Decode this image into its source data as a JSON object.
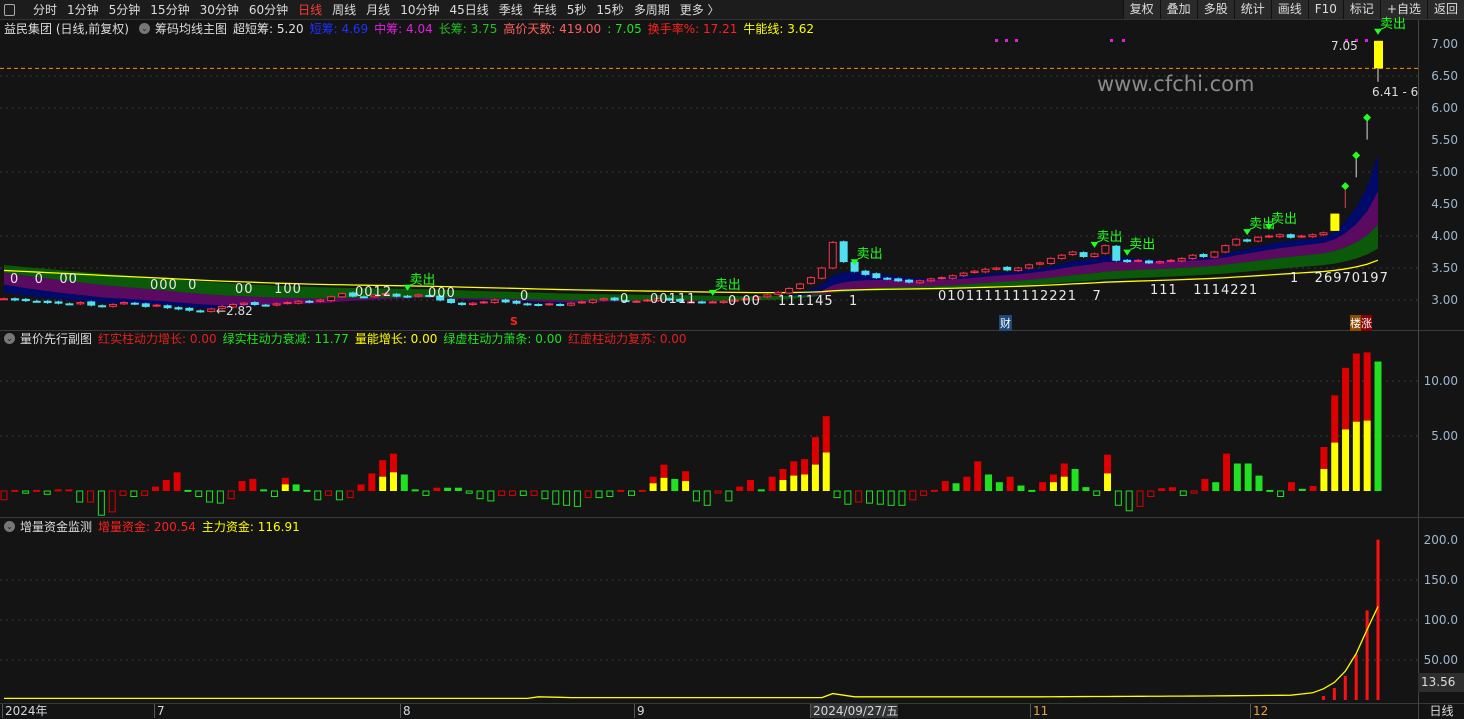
{
  "toolbar": {
    "periods": [
      "分时",
      "1分钟",
      "5分钟",
      "15分钟",
      "30分钟",
      "60分钟",
      "日线",
      "周线",
      "月线",
      "10分钟",
      "45日线",
      "季线",
      "年线",
      "5秒",
      "15秒",
      "多周期",
      "更多 〉"
    ],
    "active_period": "日线",
    "right_buttons": [
      "复权",
      "叠加",
      "多股",
      "统计",
      "画线",
      "F10",
      "标记",
      "+自选",
      "返回"
    ]
  },
  "main": {
    "stock": "益民集团 (日线,前复权)",
    "indicator": "筹码均线主图",
    "legend": [
      {
        "label": "超短筹: 5.20",
        "color": "#e0e0e0"
      },
      {
        "label": "短筹: 4.69",
        "color": "#2030ff"
      },
      {
        "label": "中筹: 4.04",
        "color": "#e020e0"
      },
      {
        "label": "长筹: 3.75",
        "color": "#20c020"
      },
      {
        "label": "高价天数: 419.00",
        "color": "#ff6060"
      },
      {
        "label": ": 7.05",
        "color": "#20e020"
      },
      {
        "label": "换手率%: 17.21",
        "color": "#ff2020"
      },
      {
        "label": "牛能线: 3.62",
        "color": "#ffff00"
      }
    ],
    "axis": [
      "7.00",
      "6.50",
      "6.00",
      "5.50",
      "5.00",
      "4.50",
      "4.00",
      "3.50",
      "3.00"
    ],
    "watermark": "www.cfchi.com",
    "high_label": "7.05",
    "low_label": "←2.82",
    "price_tag": "6.41 - 6",
    "limit_line": 6.62,
    "sell_label": "卖出",
    "sell_bars": [
      37,
      65,
      78,
      100,
      103,
      114,
      116,
      126
    ],
    "marker_s": "S",
    "marker_cai": "财",
    "marker_lou": "楼",
    "marker_zhang": "涨",
    "digit_rows": [
      "0   0   00",
      "000  0",
      "00    100",
      "0012",
      "000",
      "0",
      "0",
      "00111",
      "0 00",
      "111145   1",
      "010111111112221   7",
      "111   1114221",
      "1   26970197"
    ],
    "closes": [
      3.02,
      3.0,
      2.99,
      2.98,
      2.96,
      2.95,
      2.94,
      2.96,
      2.92,
      2.9,
      2.93,
      2.96,
      2.94,
      2.9,
      2.92,
      2.88,
      2.86,
      2.84,
      2.82,
      2.86,
      2.9,
      2.93,
      2.95,
      2.93,
      2.92,
      2.94,
      2.96,
      2.98,
      2.97,
      3.0,
      3.05,
      3.1,
      3.06,
      3.05,
      3.08,
      3.1,
      3.06,
      3.05,
      3.08,
      3.06,
      3.0,
      2.96,
      2.93,
      2.95,
      2.97,
      3.0,
      2.97,
      2.95,
      2.93,
      2.92,
      2.94,
      2.92,
      2.95,
      2.97,
      3.0,
      3.02,
      3.0,
      2.98,
      2.98,
      3.0,
      3.02,
      3.0,
      2.98,
      2.97,
      2.96,
      2.97,
      2.98,
      3.0,
      3.02,
      3.05,
      3.08,
      3.12,
      3.18,
      3.25,
      3.35,
      3.5,
      3.9,
      3.6,
      3.45,
      3.4,
      3.35,
      3.33,
      3.3,
      3.28,
      3.3,
      3.33,
      3.35,
      3.38,
      3.42,
      3.45,
      3.48,
      3.5,
      3.47,
      3.5,
      3.55,
      3.58,
      3.65,
      3.7,
      3.75,
      3.68,
      3.72,
      3.85,
      3.62,
      3.6,
      3.62,
      3.58,
      3.6,
      3.62,
      3.65,
      3.7,
      3.68,
      3.75,
      3.85,
      3.95,
      3.92,
      3.98,
      4.0,
      4.02,
      3.98,
      4.0,
      4.02,
      4.05,
      4.35,
      4.78,
      5.26,
      5.85,
      7.05
    ],
    "limit_up_bars": [
      122,
      126
    ],
    "one_word_bars": [
      123,
      124,
      125
    ]
  },
  "sub1": {
    "title": "量价先行副图",
    "legend": [
      {
        "label": "红实柱动力增长: 0.00",
        "color": "#e02020"
      },
      {
        "label": "绿实柱动力衰减: 11.77",
        "color": "#20e020"
      },
      {
        "label": "量能增长: 0.00",
        "color": "#ffff00"
      },
      {
        "label": "绿虚柱动力萧条: 0.00",
        "color": "#20e020"
      },
      {
        "label": "红虚柱动力复苏: 0.00",
        "color": "#e02020"
      }
    ],
    "axis": [
      "10.00",
      "5.00"
    ],
    "bars": [
      "R:-0.8",
      "r:0.1",
      "G:-0.2",
      "r:0.1",
      "G:-0.3",
      "r:0.15",
      "r:0.15",
      "G:-1",
      "R:-1",
      "G:-2.2",
      "R:-1.9",
      "R:-0.4",
      "G:-0.5",
      "R:-0.4",
      "r:0.4",
      "r:1.0",
      "r:1.7",
      "g:0.1",
      "G:-0.5",
      "G:-1",
      "G:-1.1",
      "R:-0.7",
      "r:0.9",
      "r:1.1",
      "g:0.15",
      "G:-0.5",
      "y:1.2:0.6",
      "g:0.6",
      "g:0.1",
      "G:-0.8",
      "R:-0.4",
      "G:-0.8",
      "R:-0.6",
      "r:0.6",
      "r:1.6",
      "y:2.8:1.3",
      "y:3.4:1.7",
      "g:1.5",
      "g:0.15",
      "G:-0.4",
      "r:0.3",
      "g:0.3",
      "g:0.3",
      "G:-0.2",
      "G:-0.7",
      "G:-0.9",
      "R:-0.4",
      "R:-0.4",
      "G:-0.4",
      "R:-0.4",
      "G:-0.7",
      "G:-1.2",
      "G:-1.3",
      "G:-1.4",
      "R:-0.6",
      "G:-0.6",
      "G:-0.5",
      "r:0.1",
      "G:-0.4",
      "r:0.1",
      "y:1.3:0.7",
      "y:2.4:1.2",
      "g:1.1",
      "y:1.8:0.9",
      "G:-0.9",
      "G:-1.3",
      "R:-0.1",
      "G:-0.9",
      "r:0.4",
      "r:1.0",
      "g:0.15",
      "r:1.3",
      "y:2.0:1.0",
      "y:2.7:1.4",
      "y:2.9:1.5",
      "y:4.9:2.4",
      "y:6.8:3.5",
      "G:-0.6",
      "G:-1.2",
      "R:-1.0",
      "G:-1.1",
      "G:-1.2",
      "G:-1.3",
      "G:-1.3",
      "R:-0.8",
      "R:-0.4",
      "r:0.1",
      "r:0.9",
      "g:0.7",
      "r:1.3",
      "r:2.7",
      "g:1.5",
      "g:0.8",
      "r:1.3",
      "g:0.5",
      "g:0.1",
      "r:0.8",
      "y:1.5:0.8",
      "y:2.5:1.3",
      "g:2.0",
      "g:0.35",
      "G:-0.4",
      "y:3.3:1.6",
      "G:-1.3",
      "G:-1.8",
      "R:-1.4",
      "R:-0.5",
      "r:0.25",
      "r:0.35",
      "G:-0.4",
      "R:-0.2",
      "r:1.1",
      "g:0.8",
      "r:3.4",
      "g:2.5",
      "g:2.5",
      "g:1.4",
      "g:0.1",
      "G:-0.5",
      "r:0.8",
      "g:0.2",
      "r:0.45",
      "y:4.0:2.0",
      "y:8.7:4.4",
      "y:11.2:5.6",
      "y:12.5:6.3",
      "y:12.6:6.4",
      "g:11.77"
    ]
  },
  "sub2": {
    "title": "增量资金监测",
    "legend": [
      {
        "label": "增量资金: 200.54",
        "color": "#ff2020"
      },
      {
        "label": "主力资金: 116.91",
        "color": "#ffff00"
      }
    ],
    "axis": [
      "200.0",
      "150.0",
      "100.0",
      "50.00"
    ],
    "current": "13.56",
    "increment": [
      [
        121,
        5
      ],
      [
        122,
        15
      ],
      [
        123,
        30
      ],
      [
        124,
        57
      ],
      [
        125,
        112
      ],
      [
        126,
        200.54
      ]
    ],
    "main_fund": [
      [
        0,
        2
      ],
      [
        48,
        2
      ],
      [
        49,
        4
      ],
      [
        52,
        3
      ],
      [
        75,
        3
      ],
      [
        76,
        8
      ],
      [
        78,
        4
      ],
      [
        95,
        4
      ],
      [
        110,
        5
      ],
      [
        118,
        6
      ],
      [
        120,
        9
      ],
      [
        121,
        14
      ],
      [
        122,
        22
      ],
      [
        123,
        36
      ],
      [
        124,
        58
      ],
      [
        125,
        88
      ],
      [
        126,
        116.91
      ]
    ]
  },
  "time_axis": [
    "2024年",
    "7",
    "8",
    "9",
    "2024/09/27/五",
    "11",
    "12"
  ],
  "period_label": "日线"
}
